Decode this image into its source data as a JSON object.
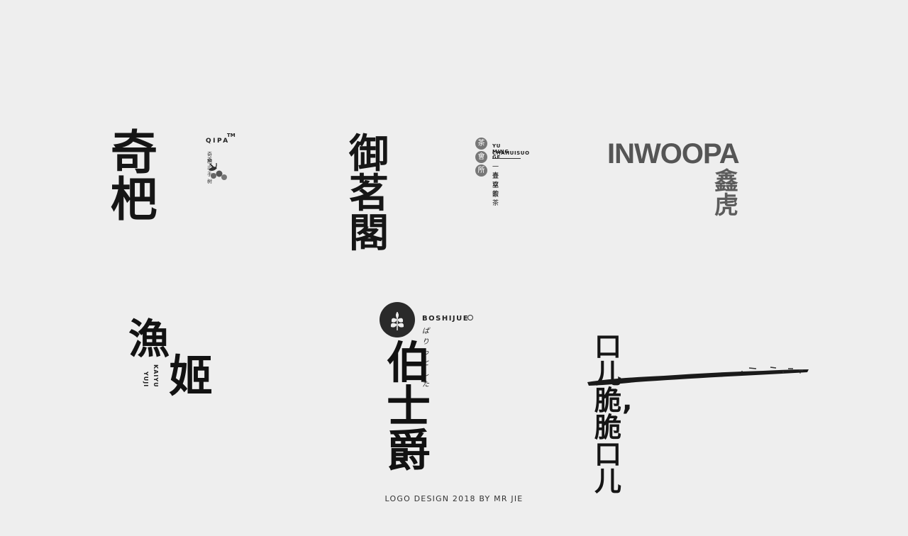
{
  "logos": {
    "qipa": {
      "main": "奇杷",
      "latin": "QIPA",
      "tm": "TM",
      "sub_line1": "奇杷",
      "sub_line2": "奇止手树"
    },
    "yu_ming_ge": {
      "main": "御茗閣",
      "seal": [
        "茶",
        "會",
        "所"
      ],
      "latin_line1": "YU MING GE",
      "latin_line2": "CHAHUISUO",
      "sub_line1": "一壶皇家",
      "sub_line2": "喜欢的茶"
    },
    "inwoopa": {
      "latin": "INWOOPA",
      "cn": "鑫虎"
    },
    "yu_ji": {
      "char1": "漁",
      "char2": "姬",
      "latin_col1": "YUJI",
      "latin_col2": "KAIYU"
    },
    "boshijue": {
      "latin": "BOSHIJUE",
      "jp": "ぱりっとした",
      "main": "伯士爵"
    },
    "kou_er_cui": {
      "main": "口儿脆,脆口儿"
    }
  },
  "footer": "LOGO DESIGN  2018 BY MR JIE",
  "colors": {
    "background": "#eeeeee",
    "ink": "#141414",
    "inwoopa_gray": "#555555"
  }
}
